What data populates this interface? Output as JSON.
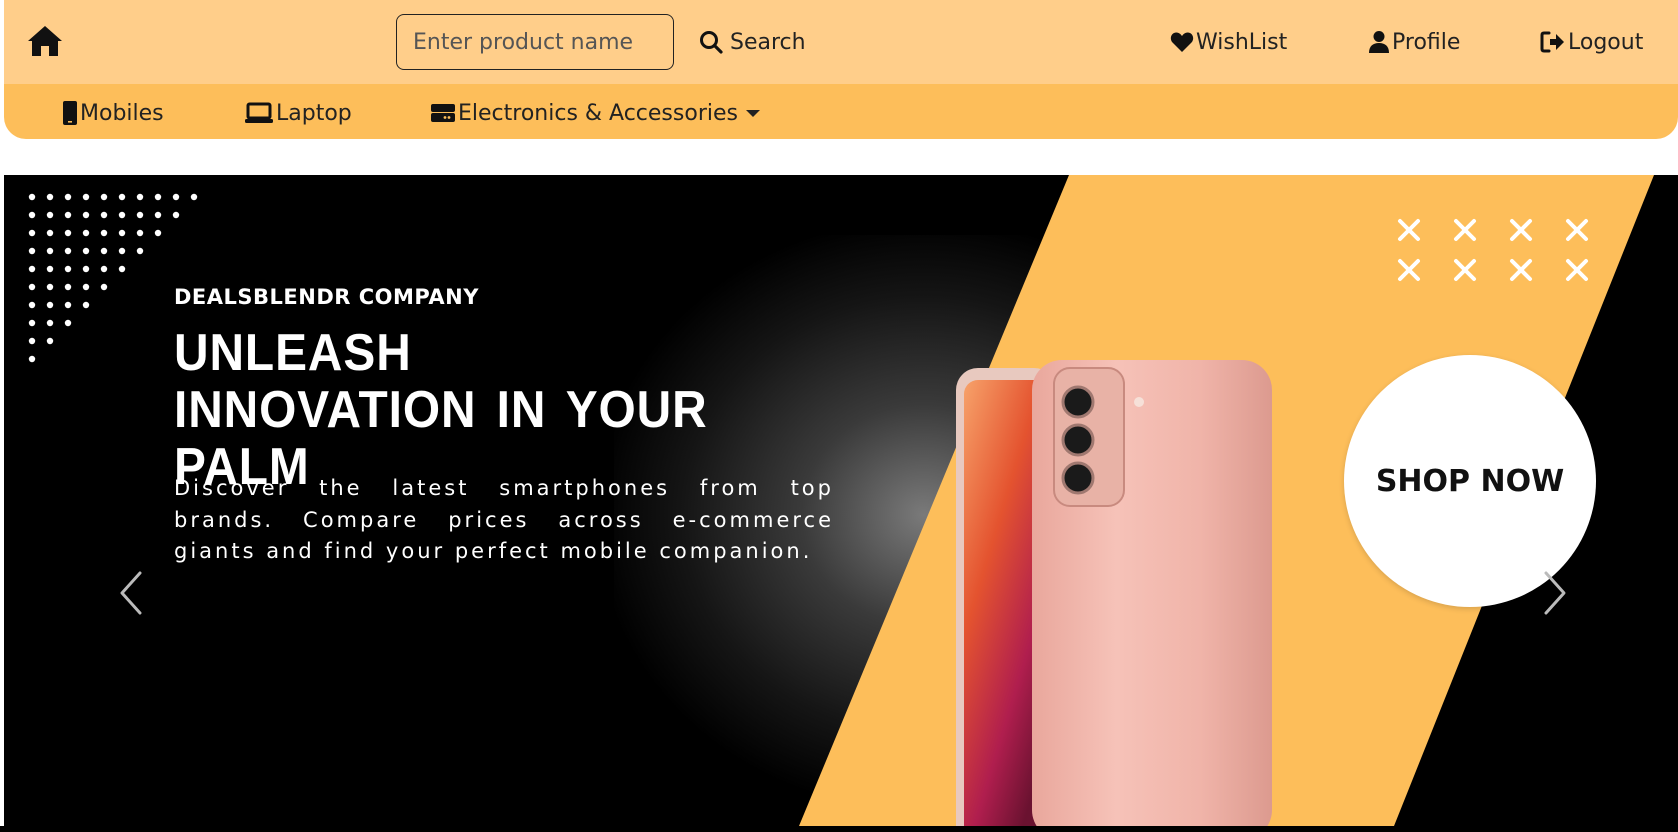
{
  "header": {
    "search": {
      "placeholder": "Enter product name",
      "button_label": "Search"
    },
    "links": {
      "wishlist": "WishList",
      "profile": "Profile",
      "logout": "Logout"
    }
  },
  "categories": {
    "mobiles": "Mobiles",
    "laptop": "Laptop",
    "electronics": "Electronics & Accessories"
  },
  "hero": {
    "brand": "DEALSBLENDR COMPANY",
    "headline": "UNLEASH INNOVATION IN YOUR PALM",
    "description": "Discover the latest smartphones from top brands. Compare prices across e-commerce giants and find your perfect mobile companion.",
    "cta": "SHOP NOW"
  },
  "colors": {
    "top_bar": "#ffce8a",
    "category_bar": "#fdbe5a",
    "hero_background": "#000000",
    "hero_accent": "#fdbe5a",
    "phone_body": "#f2b6ab"
  },
  "icons": {
    "home": "home-icon",
    "search": "search-icon",
    "wishlist": "heart-icon",
    "profile": "user-icon",
    "logout": "logout-icon",
    "mobiles": "mobile-icon",
    "laptop": "laptop-icon",
    "electronics": "hdd-icon",
    "dropdown": "caret-down-icon",
    "prev": "chevron-left-icon",
    "next": "chevron-right-icon"
  }
}
